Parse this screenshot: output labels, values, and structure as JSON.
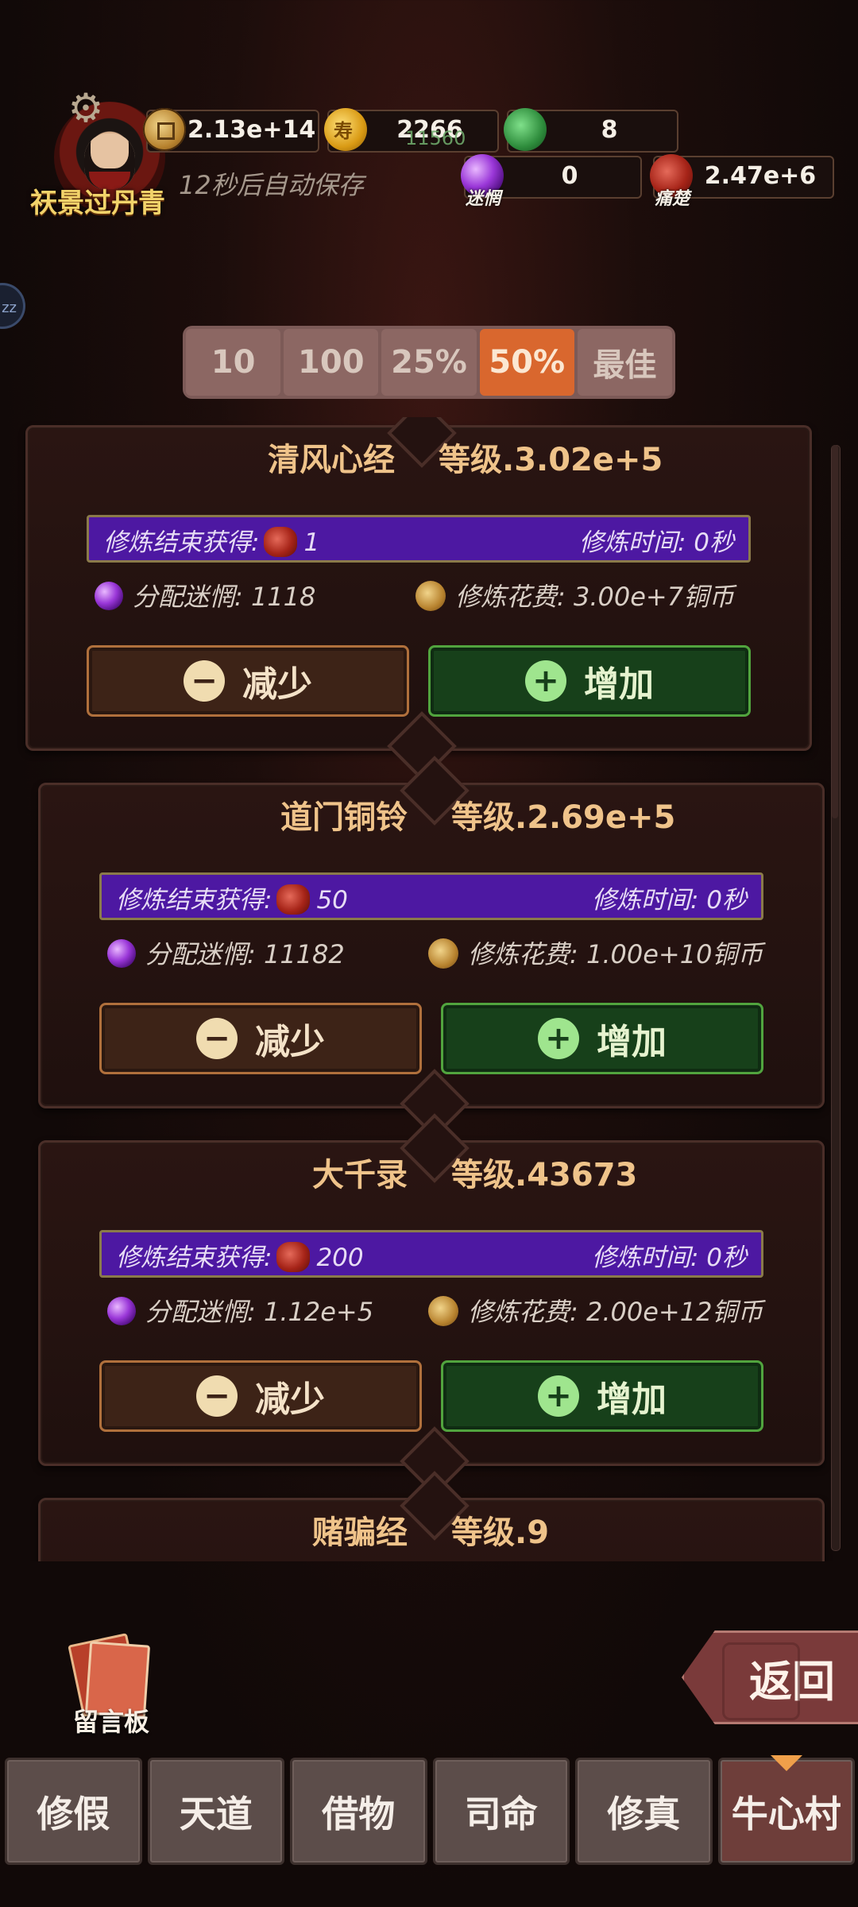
{
  "player": {
    "name": "祆景过丹青",
    "autosave_text": "12秒后自动保存"
  },
  "resources": {
    "copper": "2.13e+14",
    "gold": "2266",
    "gold_overlay": "11560",
    "jade": "8",
    "confusion": {
      "label": "迷惘",
      "value": "0"
    },
    "pain": {
      "label": "痛楚",
      "value": "2.47e+6"
    }
  },
  "side_bubble": "zz",
  "multipliers": [
    "10",
    "100",
    "25%",
    "50%",
    "最佳"
  ],
  "active_multiplier": "50%",
  "cards": [
    {
      "name": "清风心经",
      "level": "等级.3.02e+5",
      "reward_label": "修炼结束获得:",
      "reward_amount": "1",
      "time": "修炼时间: 0秒",
      "allocated": "分配迷惘: 1118",
      "cost": "修炼花费: 3.00e+7铜币",
      "decrease": "减少",
      "increase": "增加"
    },
    {
      "name": "道门铜铃",
      "level": "等级.2.69e+5",
      "reward_label": "修炼结束获得:",
      "reward_amount": "50",
      "time": "修炼时间: 0秒",
      "allocated": "分配迷惘: 11182",
      "cost": "修炼花费: 1.00e+10铜币",
      "decrease": "减少",
      "increase": "增加"
    },
    {
      "name": "大千录",
      "level": "等级.43673",
      "reward_label": "修炼结束获得:",
      "reward_amount": "200",
      "time": "修炼时间: 0秒",
      "allocated": "分配迷惘: 1.12e+5",
      "cost": "修炼花费: 2.00e+12铜币",
      "decrease": "减少",
      "increase": "增加"
    },
    {
      "name": "赌骗经",
      "level": "等级.9"
    }
  ],
  "message_board": "留言板",
  "back": "返回",
  "nav": [
    "修假",
    "天道",
    "借物",
    "司命",
    "修真",
    "牛心村"
  ],
  "active_nav": "牛心村"
}
